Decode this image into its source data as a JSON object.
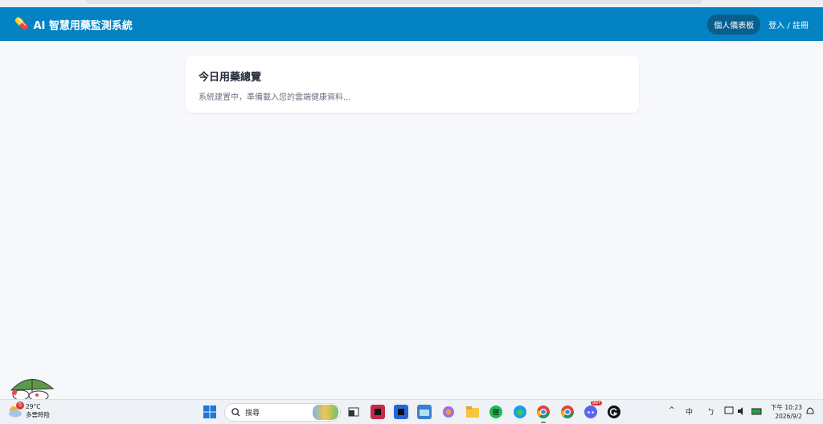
{
  "app": {
    "title": "AI 智慧用藥監測系統",
    "nav_dashboard": "個人儀表板",
    "nav_login": "登入 / 註冊"
  },
  "card": {
    "title": "今日用藥總覽",
    "subtitle": "系統建置中，準備載入您的雲端健康資料..."
  },
  "taskbar": {
    "weather_temp": "29°C",
    "weather_desc": "多雲時陰",
    "weather_badge": "5",
    "search_placeholder": "搜尋",
    "ime": "中",
    "ime2": "ㄅ",
    "clock_time": "下午 10:23",
    "clock_date": "2026/9/2",
    "notif_badge": "99+"
  },
  "colors": {
    "header": "#0383c4",
    "page_bg": "#f7f8fb"
  }
}
